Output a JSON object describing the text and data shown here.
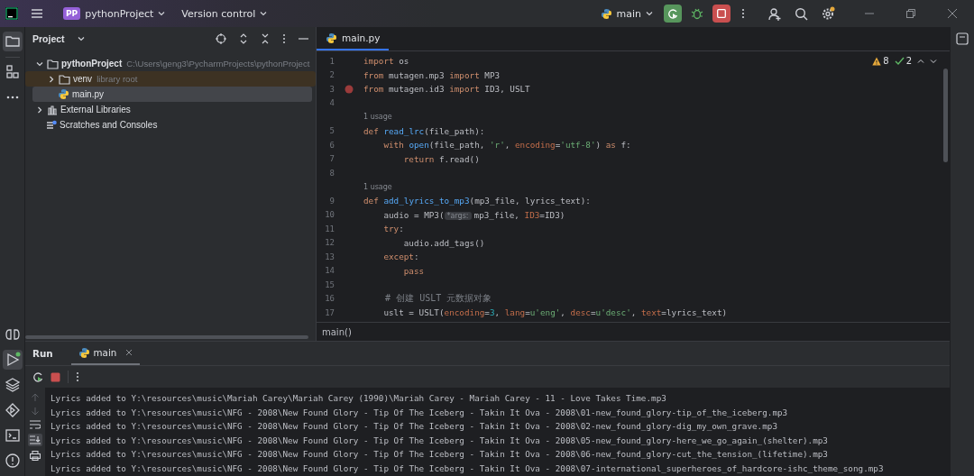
{
  "title_bar": {
    "project_badge": "PP",
    "project": "pythonProject",
    "vcs": "Version control",
    "run_config": "main"
  },
  "left_toolbar": {
    "top": [
      {
        "kind": "folder",
        "selected": true
      },
      {
        "kind": "structure",
        "selected": false
      },
      {
        "kind": "more",
        "selected": false
      }
    ],
    "bottom": [
      {
        "kind": "console",
        "selected": false
      },
      {
        "kind": "run",
        "selected": true
      },
      {
        "kind": "layers",
        "selected": false
      },
      {
        "kind": "services",
        "selected": false
      },
      {
        "kind": "terminal",
        "selected": false
      },
      {
        "kind": "problems",
        "selected": false
      }
    ]
  },
  "project_panel": {
    "title": "Project",
    "tree": [
      {
        "label": "pythonProject",
        "kind": "folder",
        "note": "C:\\Users\\geng3\\PycharmProjects\\pythonProject",
        "expanded": true,
        "selected": false,
        "highlighted": false,
        "children": [
          {
            "label": "venv",
            "kind": "folder",
            "note": "library root",
            "expanded": false,
            "selected": false,
            "highlighted": true
          },
          {
            "label": "main.py",
            "kind": "python",
            "selected": true,
            "highlighted": false
          }
        ]
      },
      {
        "label": "External Libraries",
        "kind": "library",
        "expanded": false,
        "selected": false,
        "highlighted": false
      },
      {
        "label": "Scratches and Consoles",
        "kind": "scratches",
        "selected": false,
        "highlighted": false
      }
    ]
  },
  "editor": {
    "tabs": [
      {
        "label": "main.py",
        "selected": true
      }
    ],
    "warnings": "8",
    "checks": "2",
    "breadcrumb": "main()",
    "lines": [
      {
        "kind": "code",
        "number": "1",
        "tokens": [
          {
            "text": "import",
            "kind": "kw"
          },
          {
            "text": " os",
            "kind": "plain"
          }
        ]
      },
      {
        "kind": "code",
        "number": "2",
        "tokens": [
          {
            "text": "from",
            "kind": "kw"
          },
          {
            "text": " mutagen.mp3 ",
            "kind": "plain"
          },
          {
            "text": "import",
            "kind": "kw"
          },
          {
            "text": " MP3",
            "kind": "plain"
          }
        ]
      },
      {
        "kind": "code",
        "number": "3",
        "breakpoint": true,
        "tokens": [
          {
            "text": "from",
            "kind": "kw"
          },
          {
            "text": " mutagen.id3 ",
            "kind": "plain"
          },
          {
            "text": "import",
            "kind": "kw"
          },
          {
            "text": " ID3, USLT",
            "kind": "plain"
          }
        ]
      },
      {
        "kind": "code",
        "number": "4"
      },
      {
        "kind": "usage",
        "text": "1 usage"
      },
      {
        "kind": "code",
        "number": "5",
        "tokens": [
          {
            "text": "def ",
            "kind": "kw"
          },
          {
            "text": "read_lrc",
            "kind": "fn"
          },
          {
            "text": "(file_path):",
            "kind": "plain"
          }
        ]
      },
      {
        "kind": "code",
        "number": "6",
        "tokens": [
          {
            "text": "    with ",
            "kind": "kw"
          },
          {
            "text": "open",
            "kind": "builtin"
          },
          {
            "text": "(file_path, ",
            "kind": "plain"
          },
          {
            "text": "'r'",
            "kind": "str"
          },
          {
            "text": ", ",
            "kind": "plain"
          },
          {
            "text": "encoding",
            "kind": "named"
          },
          {
            "text": "=",
            "kind": "plain"
          },
          {
            "text": "'utf-8'",
            "kind": "str"
          },
          {
            "text": ") ",
            "kind": "plain"
          },
          {
            "text": "as",
            "kind": "kw"
          },
          {
            "text": " f:",
            "kind": "plain"
          }
        ]
      },
      {
        "kind": "code",
        "number": "7",
        "tokens": [
          {
            "text": "        return",
            "kind": "kw"
          },
          {
            "text": " f.read()",
            "kind": "plain"
          }
        ]
      },
      {
        "kind": "code",
        "number": "8"
      },
      {
        "kind": "usage",
        "text": "1 usage"
      },
      {
        "kind": "code",
        "number": "9",
        "tokens": [
          {
            "text": "def ",
            "kind": "kw"
          },
          {
            "text": "add_lyrics_to_mp3",
            "kind": "fn"
          },
          {
            "text": "(mp3_file, lyrics_text):",
            "kind": "plain"
          }
        ]
      },
      {
        "kind": "code",
        "number": "10",
        "tokens": [
          {
            "text": "    audio = MP3(",
            "kind": "plain"
          },
          {
            "text": "*args:",
            "kind": "hint"
          },
          {
            "text": "mp3_file, ",
            "kind": "plain"
          },
          {
            "text": "ID3",
            "kind": "named"
          },
          {
            "text": "=ID3)",
            "kind": "plain"
          }
        ]
      },
      {
        "kind": "code",
        "number": "11",
        "tokens": [
          {
            "text": "    try",
            "kind": "kw"
          },
          {
            "text": ":",
            "kind": "plain"
          }
        ]
      },
      {
        "kind": "code",
        "number": "12",
        "tokens": [
          {
            "text": "        audio.add_tags()",
            "kind": "plain"
          }
        ]
      },
      {
        "kind": "code",
        "number": "13",
        "tokens": [
          {
            "text": "    except",
            "kind": "kw"
          },
          {
            "text": ":",
            "kind": "plain"
          }
        ]
      },
      {
        "kind": "code",
        "number": "14",
        "tokens": [
          {
            "text": "        pass",
            "kind": "kw"
          }
        ]
      },
      {
        "kind": "code",
        "number": "15"
      },
      {
        "kind": "code",
        "number": "16",
        "tokens": [
          {
            "text": "    # 创建 USLT 元数据对象",
            "kind": "comment"
          }
        ]
      },
      {
        "kind": "code",
        "number": "17",
        "tokens": [
          {
            "text": "    uslt = USLT(",
            "kind": "plain"
          },
          {
            "text": "encoding",
            "kind": "named"
          },
          {
            "text": "=",
            "kind": "plain"
          },
          {
            "text": "3",
            "kind": "num"
          },
          {
            "text": ", ",
            "kind": "plain"
          },
          {
            "text": "lang",
            "kind": "named"
          },
          {
            "text": "=",
            "kind": "plain"
          },
          {
            "text": "u'eng'",
            "kind": "str"
          },
          {
            "text": ", ",
            "kind": "plain"
          },
          {
            "text": "desc",
            "kind": "named"
          },
          {
            "text": "=",
            "kind": "plain"
          },
          {
            "text": "u'desc'",
            "kind": "str"
          },
          {
            "text": ", ",
            "kind": "plain"
          },
          {
            "text": "text",
            "kind": "named"
          },
          {
            "text": "=lyrics_text)",
            "kind": "plain"
          }
        ]
      }
    ]
  },
  "run_panel": {
    "title": "Run",
    "tabs": [
      {
        "label": "main",
        "selected": true
      }
    ],
    "output": [
      "Lyrics added to Y:\\resources\\music\\Mariah Carey\\Mariah Carey (1990)\\Mariah Carey - Mariah Carey - 11 - Love Takes Time.mp3",
      "Lyrics added to Y:\\resources\\music\\NFG - 2008\\New Found Glory - Tip Of The Iceberg - Takin It Ova - 2008\\01-new_found_glory-tip_of_the_iceberg.mp3",
      "Lyrics added to Y:\\resources\\music\\NFG - 2008\\New Found Glory - Tip Of The Iceberg - Takin It Ova - 2008\\02-new_found_glory-dig_my_own_grave.mp3",
      "Lyrics added to Y:\\resources\\music\\NFG - 2008\\New Found Glory - Tip Of The Iceberg - Takin It Ova - 2008\\05-new_found_glory-here_we_go_again_(shelter).mp3",
      "Lyrics added to Y:\\resources\\music\\NFG - 2008\\New Found Glory - Tip Of The Iceberg - Takin It Ova - 2008\\06-new_found_glory-cut_the_tension_(lifetime).mp3",
      "Lyrics added to Y:\\resources\\music\\NFG - 2008\\New Found Glory - Tip Of The Iceberg - Takin It Ova - 2008\\07-international_superheroes_of_hardcore-ishc_theme_song.mp3"
    ]
  }
}
